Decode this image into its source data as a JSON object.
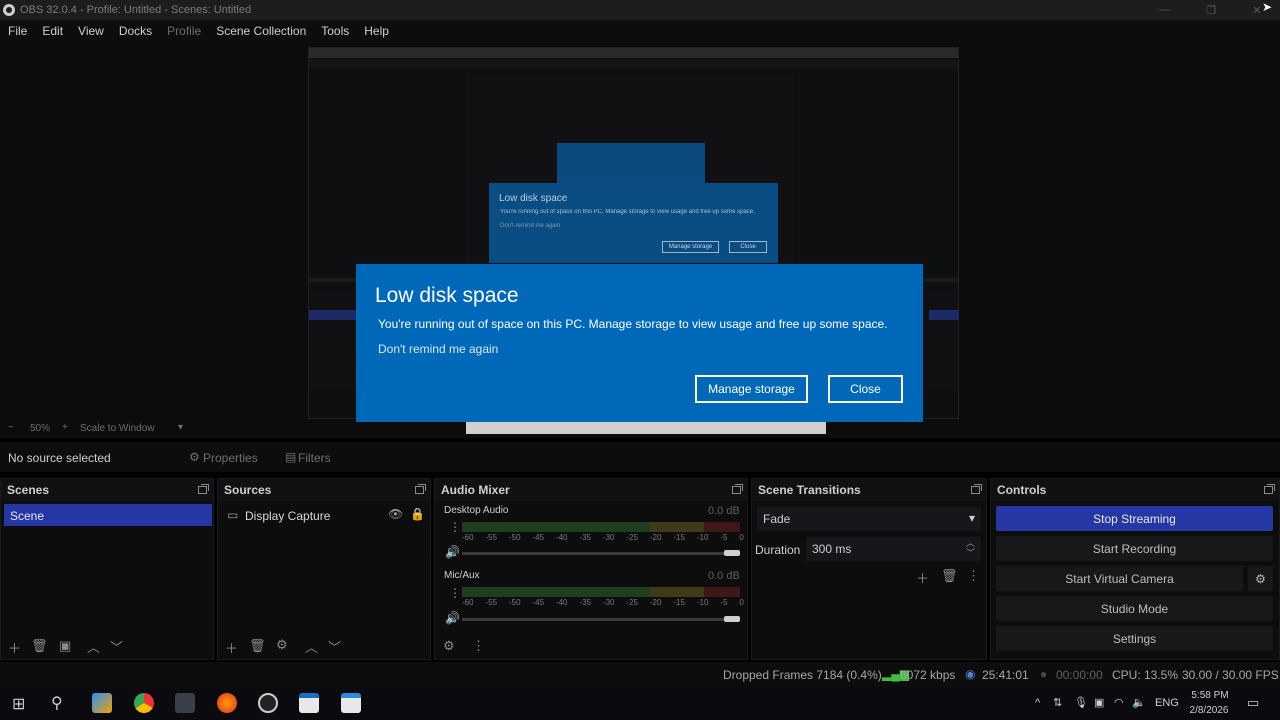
{
  "window": {
    "title": "OBS 32.0.4 - Profile: Untitled - Scenes: Untitled"
  },
  "menu": [
    "File",
    "Edit",
    "View",
    "Docks",
    "Profile",
    "Scene Collection",
    "Tools",
    "Help"
  ],
  "preview": {
    "nested_dialog_title": "Low disk space",
    "nested_dialog_text": "You're running out of space on this PC. Manage storage to view usage and free up some space.",
    "nested_dialog_remind": "Don't remind me again",
    "nested_manage": "Manage storage",
    "nested_close": "Close"
  },
  "preview_toolbar": {
    "zoom": "50%",
    "scale_mode": "Scale to Window"
  },
  "source_bar": {
    "no_source": "No source selected",
    "properties": "Properties",
    "filters": "Filters"
  },
  "scenes": {
    "header": "Scenes",
    "items": [
      "Scene"
    ]
  },
  "sources": {
    "header": "Sources",
    "items": [
      "Display Capture"
    ]
  },
  "audio_mixer": {
    "header": "Audio Mixer",
    "channels": [
      {
        "name": "Desktop Audio",
        "db": "0.0 dB"
      },
      {
        "name": "Mic/Aux",
        "db": "0.0 dB"
      }
    ],
    "scale": [
      "-60",
      "-55",
      "-50",
      "-45",
      "-40",
      "-35",
      "-30",
      "-25",
      "-20",
      "-15",
      "-10",
      "-5",
      "0"
    ]
  },
  "transitions": {
    "header": "Scene Transitions",
    "selected": "Fade",
    "duration_label": "Duration",
    "duration_value": "300 ms"
  },
  "controls": {
    "header": "Controls",
    "buttons": [
      "Stop Streaming",
      "Start Recording",
      "Start Virtual Camera",
      "Studio Mode",
      "Settings"
    ]
  },
  "status": {
    "dropped": "Dropped Frames 7184 (0.4%)",
    "kbps": "6072 kbps",
    "stream_time": "25:41:01",
    "rec_time": "00:00:00",
    "cpu": "CPU: 13.5%",
    "fps": "30.00 / 30.00 FPS"
  },
  "dialog": {
    "title": "Low disk space",
    "message": "You're running out of space on this PC. Manage storage to view usage and free up some space.",
    "remind": "Don't remind me again",
    "manage": "Manage storage",
    "close": "Close"
  },
  "taskbar": {
    "lang": "ENG",
    "time": "5:58 PM",
    "date": "2/8/2026"
  }
}
